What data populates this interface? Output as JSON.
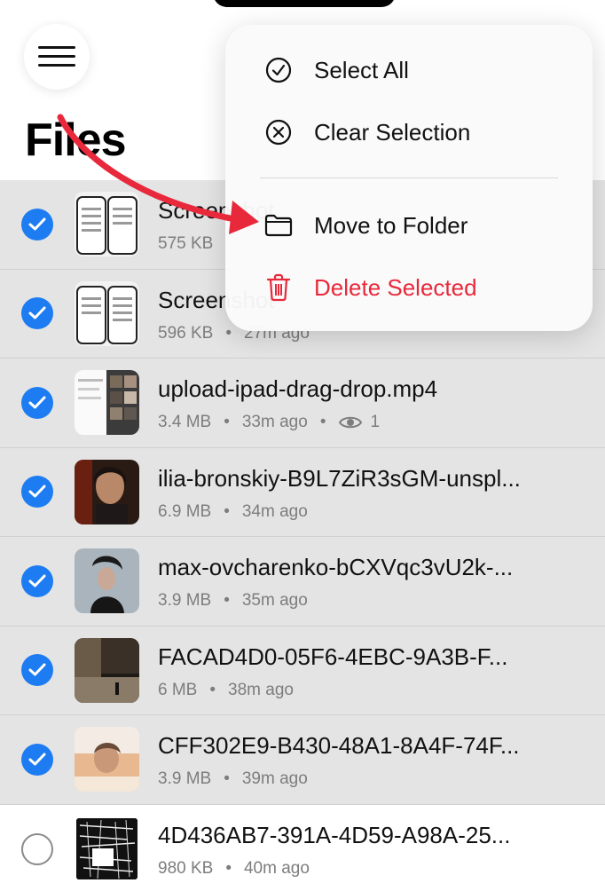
{
  "header": {
    "title": "Files"
  },
  "menu": {
    "items": [
      {
        "label": "Select All",
        "icon": "checkmark-circle-icon"
      },
      {
        "label": "Clear Selection",
        "icon": "x-circle-icon"
      },
      {
        "label": "Move to Folder",
        "icon": "folder-icon"
      },
      {
        "label": "Delete Selected",
        "icon": "trash-icon",
        "color": "#e8293b"
      }
    ]
  },
  "files": [
    {
      "name": "Screenshot",
      "size": "575 KB",
      "age": "",
      "selected": true
    },
    {
      "name": "Screenshot",
      "size": "596 KB",
      "age": "27m ago",
      "selected": true
    },
    {
      "name": "upload-ipad-drag-drop.mp4",
      "size": "3.4 MB",
      "age": "33m ago",
      "views": "1",
      "selected": true
    },
    {
      "name": "ilia-bronskiy-B9L7ZiR3sGM-unspl...",
      "size": "6.9 MB",
      "age": "34m ago",
      "selected": true
    },
    {
      "name": "max-ovcharenko-bCXVqc3vU2k-...",
      "size": "3.9 MB",
      "age": "35m ago",
      "selected": true
    },
    {
      "name": "FACAD4D0-05F6-4EBC-9A3B-F...",
      "size": "6 MB",
      "age": "38m ago",
      "selected": true
    },
    {
      "name": "CFF302E9-B430-48A1-8A4F-74F...",
      "size": "3.9 MB",
      "age": "39m ago",
      "selected": true
    },
    {
      "name": "4D436AB7-391A-4D59-A98A-25...",
      "size": "980 KB",
      "age": "40m ago",
      "selected": false
    }
  ],
  "colors": {
    "accent": "#1d7cf2",
    "danger": "#e8293b",
    "arrow": "#e8293b",
    "selected_row": "#e4e4e4"
  }
}
